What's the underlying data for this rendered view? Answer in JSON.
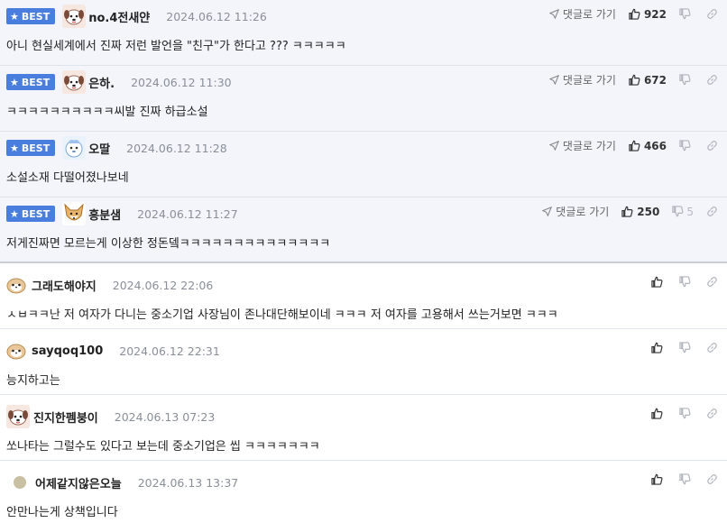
{
  "best_badge": "BEST",
  "reply_label": "댓글로 가기",
  "colors": {
    "badge": "#4a7ede",
    "best_bg": "#f3f5fb",
    "date": "#8a8f98"
  },
  "best_comments": [
    {
      "nick": "no.4전새얀",
      "date": "2024.06.12 11:26",
      "text": "아니 현실세계에서 진짜 저런 발언을 \"친구\"가 한다고 ??? ㅋㅋㅋㅋㅋ",
      "likes": "922",
      "dislikes": "",
      "avatar": "dog-icon"
    },
    {
      "nick": "은하.",
      "date": "2024.06.12 11:30",
      "text": "ㅋㅋㅋㅋㅋㅋㅋㅋㅋㅋ씨발 진짜 하급소설",
      "likes": "672",
      "dislikes": "",
      "avatar": "dog-icon"
    },
    {
      "nick": "오딸",
      "date": "2024.06.12 11:28",
      "text": "소설소재 다떨어졌나보네",
      "likes": "466",
      "dislikes": "",
      "avatar": "blue-creature-icon"
    },
    {
      "nick": "흥분샘",
      "date": "2024.06.12 11:27",
      "text": "저게진짜면 모르는게 이상한 정돈뎈ㅋㅋㅋㅋㅋㅋㅋㅋㅋㅋㅋㅋㅋㅋ",
      "likes": "250",
      "dislikes": "5",
      "avatar": "fox-icon"
    }
  ],
  "comments": [
    {
      "nick": "그래도해야지",
      "date": "2024.06.12 22:06",
      "text": "ㅅㅂㅋㅋ난 저 여자가 다니는 중소기업 사장님이 존나대단해보이네 ㅋㅋㅋ 저 여자를 고용해서 쓰는거보면 ㅋㅋㅋ",
      "avatar": "hamster-icon"
    },
    {
      "nick": "sayqoq100",
      "date": "2024.06.12 22:31",
      "text": "능지하고는",
      "avatar": "hamster-icon"
    },
    {
      "nick": "진지한펨붕이",
      "date": "2024.06.13 07:23",
      "text": "쏘나타는 그럴수도 있다고 보는데 중소기업은 씹 ㅋㅋㅋㅋㅋㅋㅋ",
      "avatar": "dog-icon"
    },
    {
      "nick": "어제같지않은오늘",
      "date": "2024.06.13 13:37",
      "text": "안만나는게 상책입니다",
      "avatar": "circle-icon"
    }
  ]
}
